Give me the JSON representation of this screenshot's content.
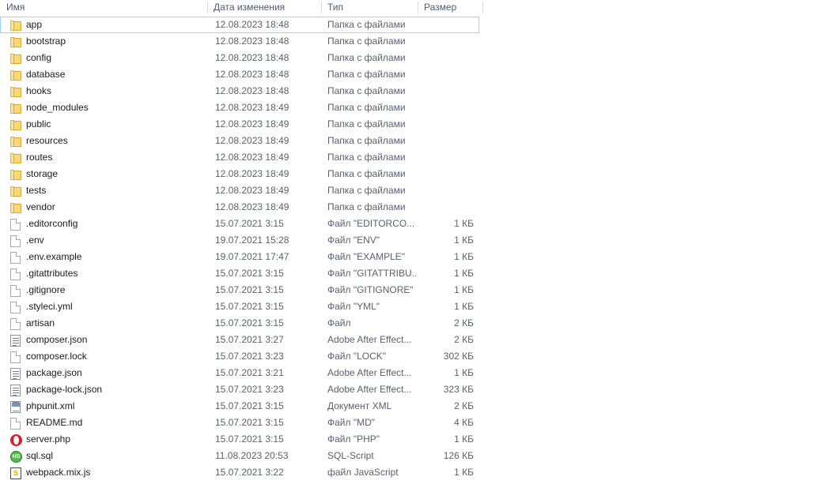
{
  "columns": [
    {
      "key": "name",
      "label": "Имя"
    },
    {
      "key": "date",
      "label": "Дата изменения"
    },
    {
      "key": "type",
      "label": "Тип"
    },
    {
      "key": "size",
      "label": "Размер"
    }
  ],
  "selection": {
    "selected_row_name": "app",
    "border_color": "#99d1f7"
  },
  "colors": {
    "header_text": "#4a5b78",
    "row_text": "#1a1a1a",
    "secondary_text": "#58616e",
    "folder_body": "#fbd978",
    "folder_tab": "#f8e2a0",
    "accent_selection": "#99d1f7"
  },
  "rows": [
    {
      "name": "app",
      "date": "12.08.2023 18:48",
      "type": "Папка с файлами",
      "size": "",
      "icon": "folder-icon",
      "selected": true
    },
    {
      "name": "bootstrap",
      "date": "12.08.2023 18:48",
      "type": "Папка с файлами",
      "size": "",
      "icon": "folder-icon",
      "selected": false
    },
    {
      "name": "config",
      "date": "12.08.2023 18:48",
      "type": "Папка с файлами",
      "size": "",
      "icon": "folder-icon",
      "selected": false
    },
    {
      "name": "database",
      "date": "12.08.2023 18:48",
      "type": "Папка с файлами",
      "size": "",
      "icon": "folder-icon",
      "selected": false
    },
    {
      "name": "hooks",
      "date": "12.08.2023 18:48",
      "type": "Папка с файлами",
      "size": "",
      "icon": "folder-icon",
      "selected": false
    },
    {
      "name": "node_modules",
      "date": "12.08.2023 18:49",
      "type": "Папка с файлами",
      "size": "",
      "icon": "folder-icon",
      "selected": false
    },
    {
      "name": "public",
      "date": "12.08.2023 18:49",
      "type": "Папка с файлами",
      "size": "",
      "icon": "folder-icon",
      "selected": false
    },
    {
      "name": "resources",
      "date": "12.08.2023 18:49",
      "type": "Папка с файлами",
      "size": "",
      "icon": "folder-icon",
      "selected": false
    },
    {
      "name": "routes",
      "date": "12.08.2023 18:49",
      "type": "Папка с файлами",
      "size": "",
      "icon": "folder-icon",
      "selected": false
    },
    {
      "name": "storage",
      "date": "12.08.2023 18:49",
      "type": "Папка с файлами",
      "size": "",
      "icon": "folder-icon",
      "selected": false
    },
    {
      "name": "tests",
      "date": "12.08.2023 18:49",
      "type": "Папка с файлами",
      "size": "",
      "icon": "folder-icon",
      "selected": false
    },
    {
      "name": "vendor",
      "date": "12.08.2023 18:49",
      "type": "Папка с файлами",
      "size": "",
      "icon": "folder-icon",
      "selected": false
    },
    {
      "name": ".editorconfig",
      "date": "15.07.2021 3:15",
      "type": "Файл \"EDITORCO...",
      "size": "1 КБ",
      "icon": "blank-file-icon",
      "selected": false
    },
    {
      "name": ".env",
      "date": "19.07.2021 15:28",
      "type": "Файл \"ENV\"",
      "size": "1 КБ",
      "icon": "blank-file-icon",
      "selected": false
    },
    {
      "name": ".env.example",
      "date": "19.07.2021 17:47",
      "type": "Файл \"EXAMPLE\"",
      "size": "1 КБ",
      "icon": "blank-file-icon",
      "selected": false
    },
    {
      "name": ".gitattributes",
      "date": "15.07.2021 3:15",
      "type": "Файл \"GITATTRIBU...",
      "size": "1 КБ",
      "icon": "blank-file-icon",
      "selected": false
    },
    {
      "name": ".gitignore",
      "date": "15.07.2021 3:15",
      "type": "Файл \"GITIGNORE\"",
      "size": "1 КБ",
      "icon": "blank-file-icon",
      "selected": false
    },
    {
      "name": ".styleci.yml",
      "date": "15.07.2021 3:15",
      "type": "Файл \"YML\"",
      "size": "1 КБ",
      "icon": "blank-file-icon",
      "selected": false
    },
    {
      "name": "artisan",
      "date": "15.07.2021 3:15",
      "type": "Файл",
      "size": "2 КБ",
      "icon": "blank-file-icon",
      "selected": false
    },
    {
      "name": "composer.json",
      "date": "15.07.2021 3:27",
      "type": "Adobe After Effect...",
      "size": "2 КБ",
      "icon": "text-document-icon",
      "selected": false
    },
    {
      "name": "composer.lock",
      "date": "15.07.2021 3:23",
      "type": "Файл \"LOCK\"",
      "size": "302 КБ",
      "icon": "blank-file-icon",
      "selected": false
    },
    {
      "name": "package.json",
      "date": "15.07.2021 3:21",
      "type": "Adobe After Effect...",
      "size": "1 КБ",
      "icon": "text-document-icon",
      "selected": false
    },
    {
      "name": "package-lock.json",
      "date": "15.07.2021 3:23",
      "type": "Adobe After Effect...",
      "size": "323 КБ",
      "icon": "text-document-icon",
      "selected": false
    },
    {
      "name": "phpunit.xml",
      "date": "15.07.2021 3:15",
      "type": "Документ XML",
      "size": "2 КБ",
      "icon": "xml-document-icon",
      "selected": false
    },
    {
      "name": "README.md",
      "date": "15.07.2021 3:15",
      "type": "Файл \"MD\"",
      "size": "4 КБ",
      "icon": "blank-file-icon",
      "selected": false
    },
    {
      "name": "server.php",
      "date": "15.07.2021 3:15",
      "type": "Файл \"PHP\"",
      "size": "1 КБ",
      "icon": "opera-browser-icon",
      "selected": false
    },
    {
      "name": "sql.sql",
      "date": "11.08.2023 20:53",
      "type": "SQL-Script",
      "size": "126 КБ",
      "icon": "heidisql-icon",
      "selected": false,
      "icon_text": "HS"
    },
    {
      "name": "webpack.mix.js",
      "date": "15.07.2021 3:22",
      "type": "файл JavaScript",
      "size": "1 КБ",
      "icon": "javascript-script-icon",
      "selected": false,
      "icon_text": "S"
    }
  ]
}
